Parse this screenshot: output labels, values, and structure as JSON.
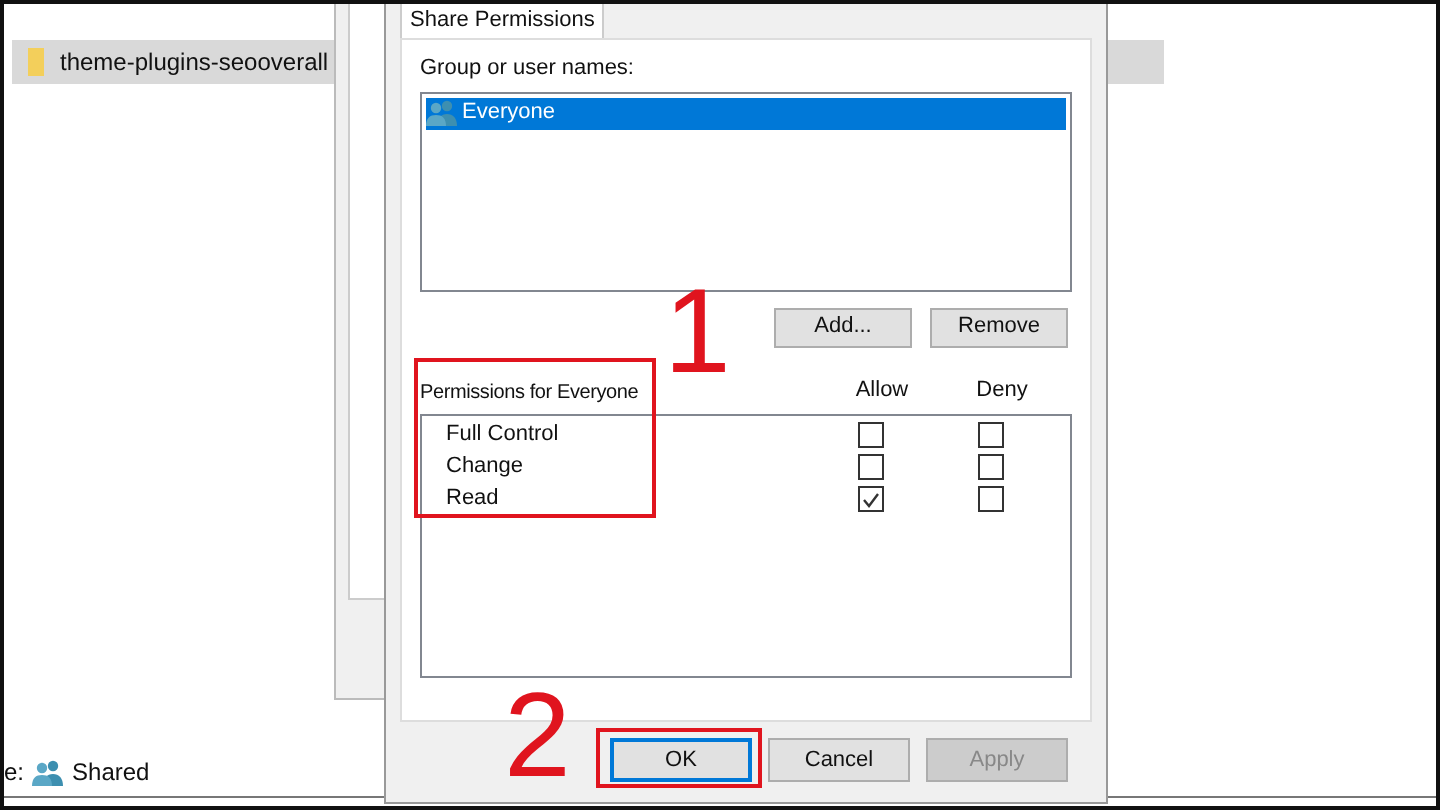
{
  "explorer": {
    "rows": [
      {
        "name": "theme-plugins-seooverall",
        "selected": true
      }
    ],
    "status_prefix": "e:",
    "status_text": "Shared"
  },
  "dialog": {
    "tabs": [
      {
        "label": "Share Permissions",
        "selected": true
      }
    ],
    "group_label": "Group or user names:",
    "users": [
      {
        "name": "Everyone",
        "selected": true
      }
    ],
    "user_buttons": [
      "Add...",
      "Remove"
    ],
    "permissions_label": "Permissions for Everyone",
    "allow_header": "Allow",
    "deny_header": "Deny",
    "permissions": [
      {
        "name": "Full Control",
        "allow": false,
        "deny": false
      },
      {
        "name": "Change",
        "allow": false,
        "deny": false
      },
      {
        "name": "Read",
        "allow": true,
        "deny": false
      }
    ],
    "buttons": [
      {
        "label": "OK",
        "default": true,
        "disabled": false
      },
      {
        "label": "Cancel",
        "default": false,
        "disabled": false
      },
      {
        "label": "Apply",
        "default": false,
        "disabled": true
      }
    ]
  },
  "annotations": [
    {
      "number": "1"
    },
    {
      "number": "2"
    }
  ]
}
